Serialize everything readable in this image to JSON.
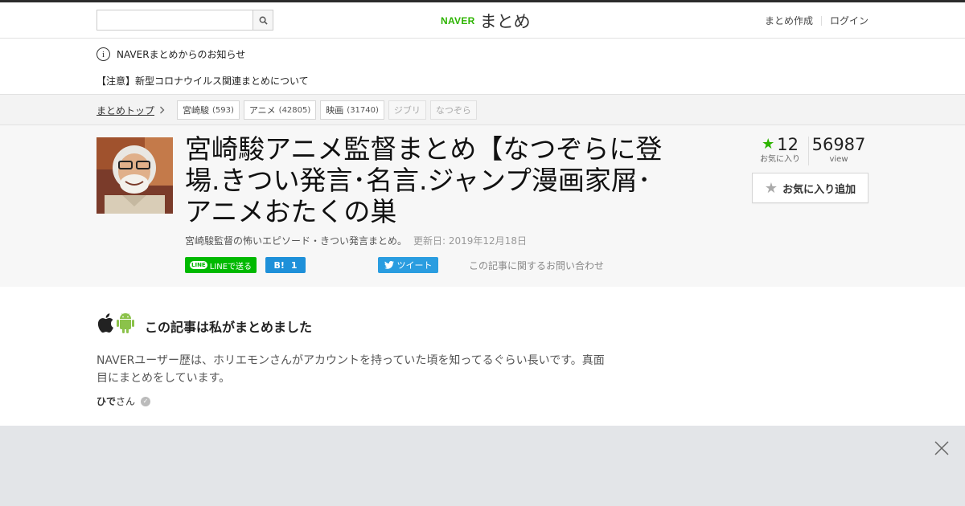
{
  "header": {
    "search_placeholder": "",
    "logo_brand": "NAVER",
    "logo_title": "まとめ",
    "create_link": "まとめ作成",
    "login_link": "ログイン"
  },
  "notice": {
    "info_label": "NAVERまとめからのお知らせ",
    "alert_link": "【注意】新型コロナウイルス関連まとめについて"
  },
  "breadcrumb": {
    "home": "まとめトップ",
    "tags": [
      {
        "label": "宮崎駿",
        "count": "(593)"
      },
      {
        "label": "アニメ",
        "count": "(42805)"
      },
      {
        "label": "映画",
        "count": "(31740)"
      },
      {
        "label": "ジブリ",
        "count": ""
      },
      {
        "label": "なつぞら",
        "count": ""
      }
    ]
  },
  "article": {
    "title": "宮崎駿アニメ監督まとめ【なつぞらに登場.きつい発言･名言.ジャンプ漫画家屑･アニメおたくの巣",
    "description": "宮崎駿監督の怖いエピソード・きつい発言まとめ。",
    "updated": "更新日: 2019年12月18日",
    "share": {
      "line": "LINEで送る",
      "hatena_count": "1",
      "tweet": "ツイート",
      "contact": "この記事に関するお問い合わせ"
    },
    "favorites": {
      "count": "12",
      "count_label": "お気に入り",
      "views": "56987",
      "views_label": "view",
      "add_button": "お気に入り追加"
    }
  },
  "author": {
    "heading": "この記事は私がまとめました",
    "bio": "NAVERユーザー歴は、ホリエモンさんがアカウントを持っていた頃を知ってるぐらい長いです。真面目にまとめをしています。",
    "name": "ひで",
    "suffix": "さん"
  },
  "colors": {
    "brand_green": "#2db400",
    "line_green": "#00b900",
    "hatena_blue": "#1e90d9",
    "twitter_blue": "#2a9de0"
  }
}
